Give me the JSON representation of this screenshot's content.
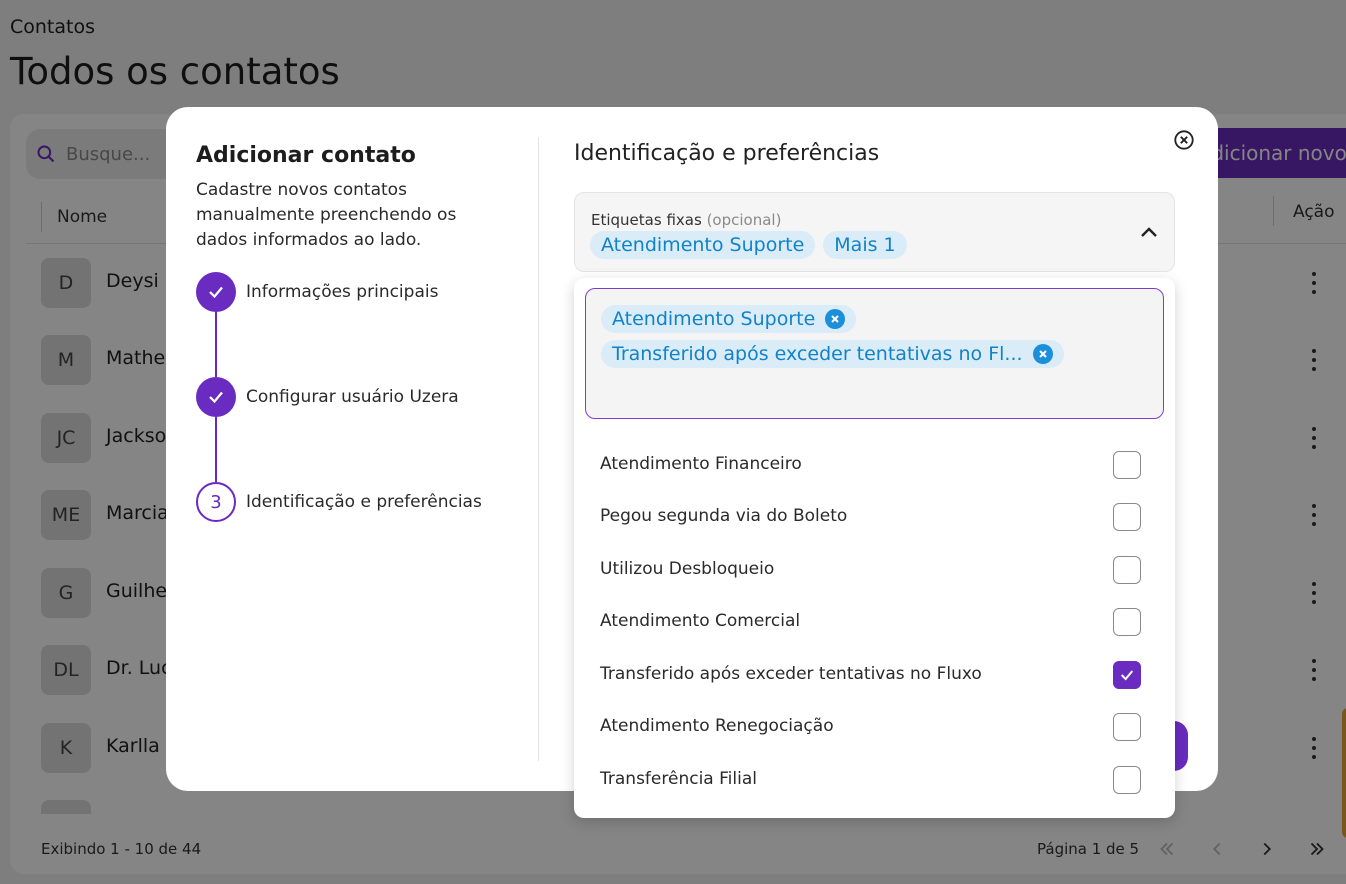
{
  "page": {
    "breadcrumb": "Contatos",
    "title": "Todos os contatos",
    "search_placeholder": "Busque...",
    "add_button": "Adicionar novo",
    "columns": {
      "name": "Nome",
      "action": "Ação"
    },
    "rows": [
      {
        "initials": "D",
        "name": "Deysi"
      },
      {
        "initials": "M",
        "name": "Mathe"
      },
      {
        "initials": "JC",
        "name": "Jackso"
      },
      {
        "initials": "ME",
        "name": "Marcia"
      },
      {
        "initials": "G",
        "name": "Guilhe"
      },
      {
        "initials": "DL",
        "name": "Dr. Luc"
      },
      {
        "initials": "K",
        "name": "Karlla"
      }
    ],
    "footer": {
      "count": "Exibindo 1 - 10 de 44",
      "page": "Página 1 de 5"
    }
  },
  "modal": {
    "title": "Adicionar contato",
    "description": "Cadastre novos contatos manualmente preenchendo os dados informados ao lado.",
    "steps": [
      {
        "label": "Informações principais",
        "status": "done"
      },
      {
        "label": "Configurar usuário Uzera",
        "status": "done"
      },
      {
        "number": "3",
        "label": "Identificação e preferências",
        "status": "current"
      }
    ],
    "section_title": "Identificação e preferências",
    "tags_field": {
      "label": "Etiquetas fixas",
      "optional": "(opcional)",
      "chips": [
        "Atendimento Suporte",
        "Mais 1"
      ]
    },
    "dropdown": {
      "selected": [
        "Atendimento Suporte",
        "Transferido após exceder tentativas no Fl..."
      ],
      "options": [
        {
          "label": "Atendimento Financeiro",
          "checked": false
        },
        {
          "label": "Pegou segunda via do Boleto",
          "checked": false
        },
        {
          "label": "Utilizou Desbloqueio",
          "checked": false
        },
        {
          "label": "Atendimento Comercial",
          "checked": false
        },
        {
          "label": "Transferido após exceder tentativas no Fluxo",
          "checked": true
        },
        {
          "label": "Atendimento Renegociação",
          "checked": false
        },
        {
          "label": "Transferência Filial",
          "checked": false
        }
      ]
    }
  },
  "colors": {
    "accent": "#6a2bc0",
    "chip_text": "#1282c8",
    "chip_bg": "#d9ecf7"
  },
  "icons": [
    "search-icon",
    "check-icon",
    "close-circle-icon",
    "chevron-up-icon",
    "chip-remove-icon",
    "kebab-icon",
    "first-page-icon",
    "prev-page-icon",
    "next-page-icon",
    "last-page-icon"
  ]
}
